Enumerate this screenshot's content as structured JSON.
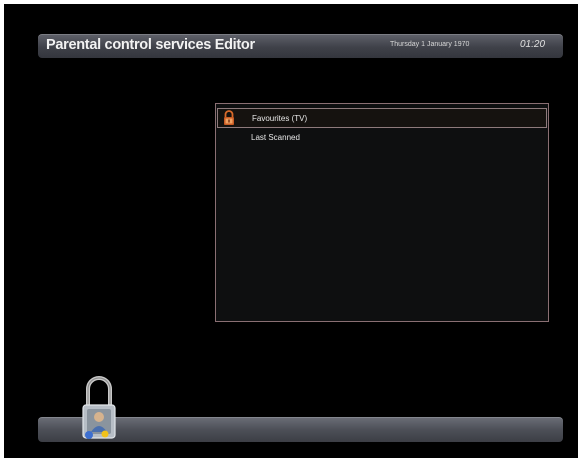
{
  "header": {
    "title": "Parental control services Editor",
    "date": "Thursday 1 January 1970",
    "time": "01:20"
  },
  "list": {
    "items": [
      {
        "label": "Favourites (TV)",
        "selected": true,
        "icon": "lock-icon"
      },
      {
        "label": "Last Scanned",
        "selected": false
      }
    ]
  },
  "decor": {
    "footer_icon": "padlock-icon"
  },
  "colors": {
    "background": "#000000",
    "bar": "#4d5058",
    "panel_border": "#8a6f73",
    "lock_accent": "#d86a2a"
  }
}
